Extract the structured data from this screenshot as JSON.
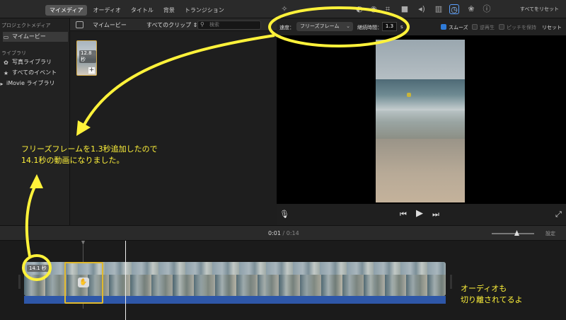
{
  "toolbar": {
    "tabs": [
      "マイメディア",
      "オーディオ",
      "タイトル",
      "背景",
      "トランジション"
    ],
    "reset_all": "すべてをリセット"
  },
  "sidebar": {
    "project_heading": "プロジェクトメディア",
    "project_item": "マイムービー",
    "library_heading": "ライブラリ",
    "items": [
      "写真ライブラリ",
      "すべてのイベント",
      "iMovie ライブラリ"
    ]
  },
  "browser": {
    "title": "マイムービー",
    "clips_filter": "すべてのクリップ",
    "search_placeholder": "検索",
    "thumb_duration": "12.8 秒"
  },
  "viewer": {
    "speed_label": "速度：",
    "speed_value": "フリーズフレーム",
    "duration_label": "継続時間：",
    "duration_value": "1.3",
    "duration_unit": "s",
    "smooth_label": "スムーズ",
    "reverse_label": "逆再生",
    "pitch_label": "ピッチを保持",
    "reset_label": "リセット"
  },
  "timeline": {
    "current_time": "0:01",
    "separator": "/",
    "total_time": "0:14",
    "settings_label": "設定",
    "clip_duration": "14.1 秒"
  },
  "annotations": {
    "note_main_line1": "フリーズフレームを1.3秒追加したので",
    "note_main_line2": "14.1秒の動画になりました。",
    "note_audio_line1": "オーディオも",
    "note_audio_line2": "切り離されてるよ",
    "color": "#fff23a"
  },
  "colors": {
    "accent": "#2f7bd8",
    "selection": "#e0b92e",
    "audio": "#2e57a8"
  }
}
